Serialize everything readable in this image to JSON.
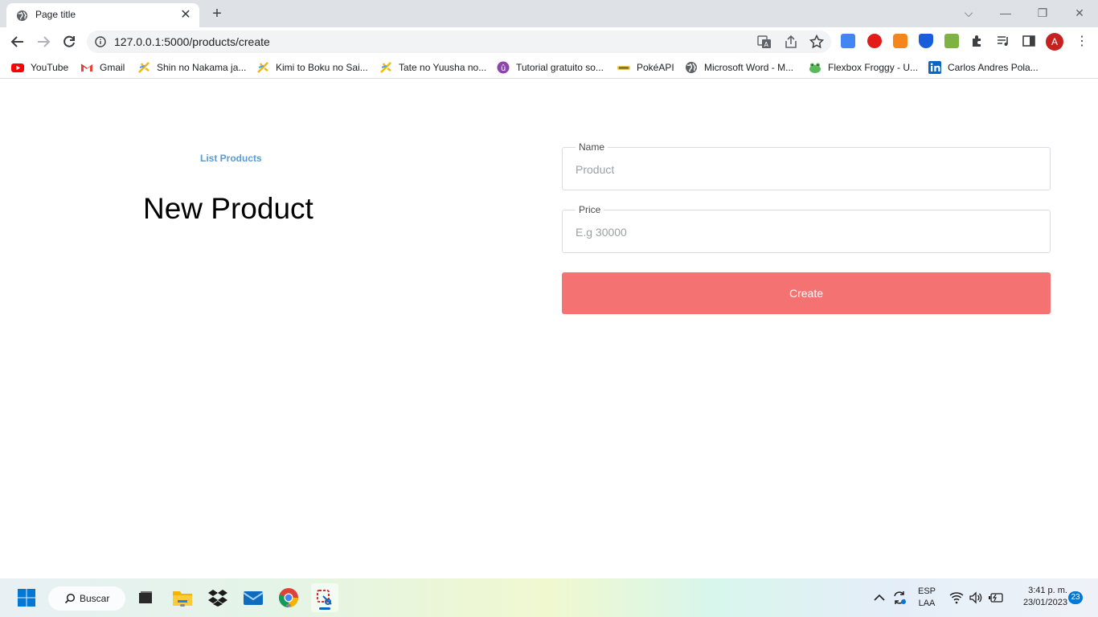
{
  "browser": {
    "tab_title": "Page title",
    "url": "127.0.0.1:5000/products/create",
    "profile_initial": "A"
  },
  "bookmarks": [
    {
      "label": "YouTube",
      "icon": "youtube-icon"
    },
    {
      "label": "Gmail",
      "icon": "gmail-icon"
    },
    {
      "label": "Shin no Nakama ja...",
      "icon": "bookmark-fav-icon"
    },
    {
      "label": "Kimi to Boku no Sai...",
      "icon": "bookmark-fav-icon"
    },
    {
      "label": "Tate no Yuusha no...",
      "icon": "bookmark-fav-icon"
    },
    {
      "label": "Tutorial gratuito so...",
      "icon": "tutorial-icon"
    },
    {
      "label": "PokéAPI",
      "icon": "pokeapi-icon"
    },
    {
      "label": "Microsoft Word - M...",
      "icon": "globe-icon"
    },
    {
      "label": "Flexbox Froggy - U...",
      "icon": "frog-icon"
    },
    {
      "label": "Carlos Andres Pola...",
      "icon": "linkedin-icon"
    }
  ],
  "page": {
    "list_link": "List Products",
    "title": "New Product",
    "form": {
      "name_label": "Name",
      "name_placeholder": "Product",
      "price_label": "Price",
      "price_placeholder": "E.g 30000",
      "submit_label": "Create"
    }
  },
  "taskbar": {
    "search_label": "Buscar",
    "language_line1": "ESP",
    "language_line2": "LAA",
    "time": "3:41 p. m.",
    "date": "23/01/2023",
    "notification_count": "23"
  },
  "colors": {
    "accent_button": "#f57272",
    "link": "#5b9bd5",
    "profile": "#c5221f"
  }
}
